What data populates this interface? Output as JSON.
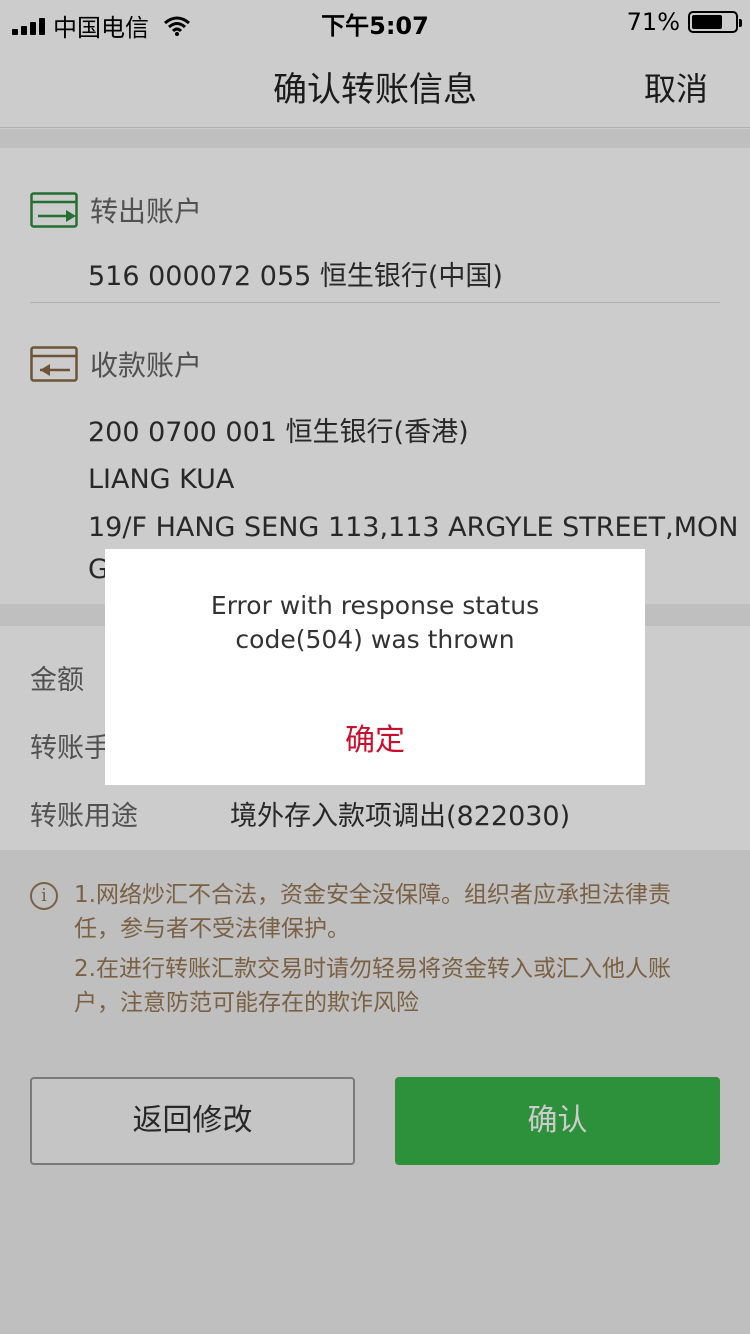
{
  "status_bar": {
    "carrier": "中国电信",
    "time": "下午5:07",
    "battery_percent": "71%",
    "battery_level": 0.71,
    "signal_icon": "signal-bars-icon",
    "wifi_icon": "wifi-icon"
  },
  "nav": {
    "title": "确认转账信息",
    "cancel_label": "取消"
  },
  "from_account": {
    "label": "转出账户",
    "icon": "transfer-out-icon",
    "value": "516 000072 055 恒生银行(中国)"
  },
  "to_account": {
    "label": "收款账户",
    "icon": "transfer-in-icon",
    "account": "200 0700 001 恒生银行(香港)",
    "name": "LIANG KUA",
    "address_line1": "19/F HANG SENG 113,113 ARGYLE STREET,MON",
    "address_line2": "G"
  },
  "details": {
    "amount_label": "金额",
    "fee_label": "转账手",
    "purpose_label": "转账用途",
    "purpose_value": "境外存入款项调出(822030)"
  },
  "notice": {
    "icon": "info-icon",
    "item1_line1": "1.网络炒汇不合法，资金安全没保障。组织者应承担法律责",
    "item1_line2": "任，参与者不受法律保护。",
    "item2_line1": "2.在进行转账汇款交易时请勿轻易将资金转入或汇入他人账",
    "item2_line2": "户，注意防范可能存在的欺诈风险"
  },
  "buttons": {
    "back_label": "返回修改",
    "confirm_label": "确认"
  },
  "dialog": {
    "message_line1": "Error with response status",
    "message_line2": "code(504) was thrown",
    "ok_label": "确定"
  },
  "colors": {
    "accent_green": "#39b54a",
    "icon_green": "#2e8b3e",
    "icon_brown": "#8a6a45",
    "notice_brown": "#9a7a55",
    "dialog_ok_red": "#c8102e"
  }
}
